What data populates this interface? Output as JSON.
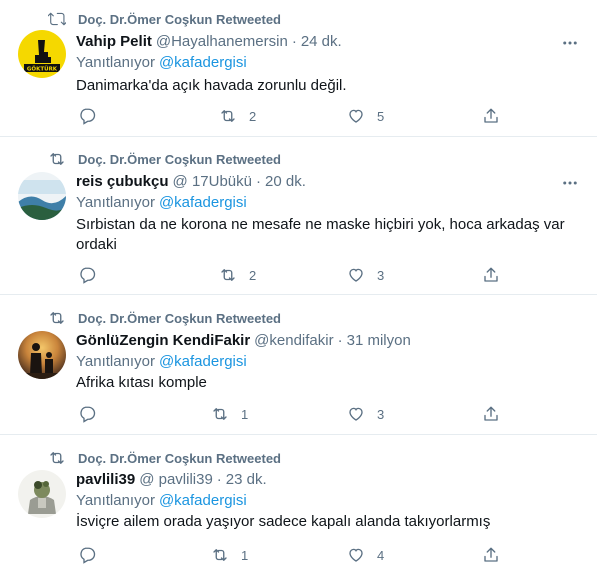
{
  "tweets": [
    {
      "retweeter": "Doç. Dr.Ömer Coşkun Retweeted",
      "name": "Vahip Pelit",
      "handle": "@Hayalhanemersin",
      "separator": "·",
      "time": "24 dk.",
      "reply_prefix": "Yanıtlanıyor",
      "reply_to": "@kafadergisi",
      "text": "Danimarka'da açık havada zorunlu değil.",
      "replies": "",
      "retweets": "2",
      "likes": "5",
      "avatar_logo_text": "GÖKTÜRK"
    },
    {
      "retweeter": "Doç. Dr.Ömer Coşkun Retweeted",
      "name": "reis çubukçu",
      "handle": "@ 17Ubükü",
      "separator": "·",
      "time": "20 dk.",
      "reply_prefix": "Yanıtlanıyor",
      "reply_to": "@kafadergisi",
      "text": "Sırbistan da ne korona ne mesafe ne maske hiçbiri yok, hoca arkadaş var ordaki",
      "replies": "",
      "retweets": "2",
      "likes": "3"
    },
    {
      "retweeter": "Doç. Dr.Ömer Coşkun Retweeted",
      "name": "GönlüZengin KendiFakir",
      "handle": "@kendifakir",
      "separator": "·",
      "time": "31 milyon",
      "reply_prefix": "Yanıtlanıyor",
      "reply_to": "@kafadergisi",
      "text": "Afrika kıtası komple",
      "replies": "",
      "retweets": "1",
      "likes": "3"
    },
    {
      "retweeter": "Doç. Dr.Ömer Coşkun Retweeted",
      "name": "pavlili39",
      "handle": "@ pavlili39",
      "separator": "·",
      "time": "23 dk.",
      "reply_prefix": "Yanıtlanıyor",
      "reply_to": "@kafadergisi",
      "text": "İsviçre ailem orada yaşıyor sadece kapalı alanda takıyorlarmış",
      "replies": "",
      "retweets": "1",
      "likes": "4"
    }
  ],
  "colors": {
    "secondary_text": "#5b7083",
    "link": "#1b95e0",
    "divider": "#e6ecf0",
    "avatar1_bg": "#f5d800"
  },
  "icons": [
    "retweet-icon",
    "more-icon",
    "reply-icon",
    "heart-icon",
    "share-icon"
  ]
}
